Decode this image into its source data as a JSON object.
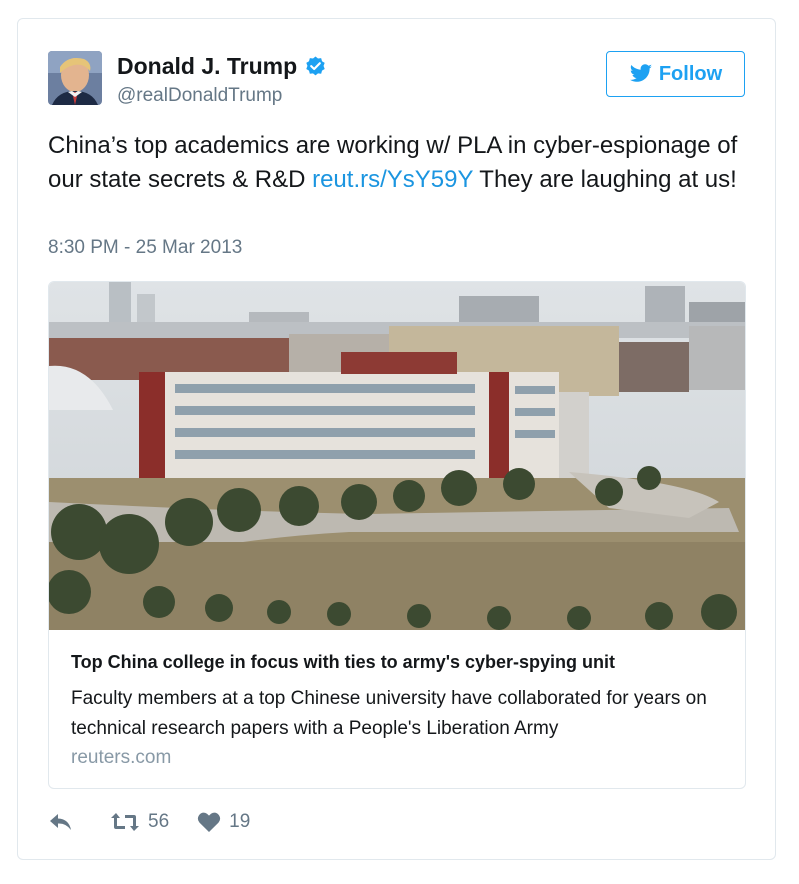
{
  "author": {
    "name": "Donald J. Trump",
    "handle": "@realDonaldTrump",
    "verified_icon": "verified-badge-icon",
    "avatar_icon": "avatar-photo"
  },
  "follow_button": {
    "label": "Follow",
    "icon": "twitter-bird-icon",
    "color": "#1da1f2"
  },
  "tweet": {
    "text_before_link": "China’s top academics are working w/ PLA in cyber-espionage of our state secrets & R&D ",
    "link_text": "reut.rs/YsY59Y",
    "text_after_link": " They are laughing at us!",
    "timestamp": "8:30 PM - 25 Mar 2013",
    "link_color": "#1b95e0"
  },
  "card": {
    "image_alt": "campus-buildings-photo",
    "title": "Top China college in focus with ties to army's cyber-spying unit",
    "description": "Faculty members at a top Chinese university have collaborated for years on technical research papers with a People's Liberation Army",
    "domain": "reuters.com"
  },
  "actions": {
    "reply_icon": "reply-icon",
    "retweet_icon": "retweet-icon",
    "retweet_count": "56",
    "like_icon": "heart-icon",
    "like_count": "19"
  }
}
